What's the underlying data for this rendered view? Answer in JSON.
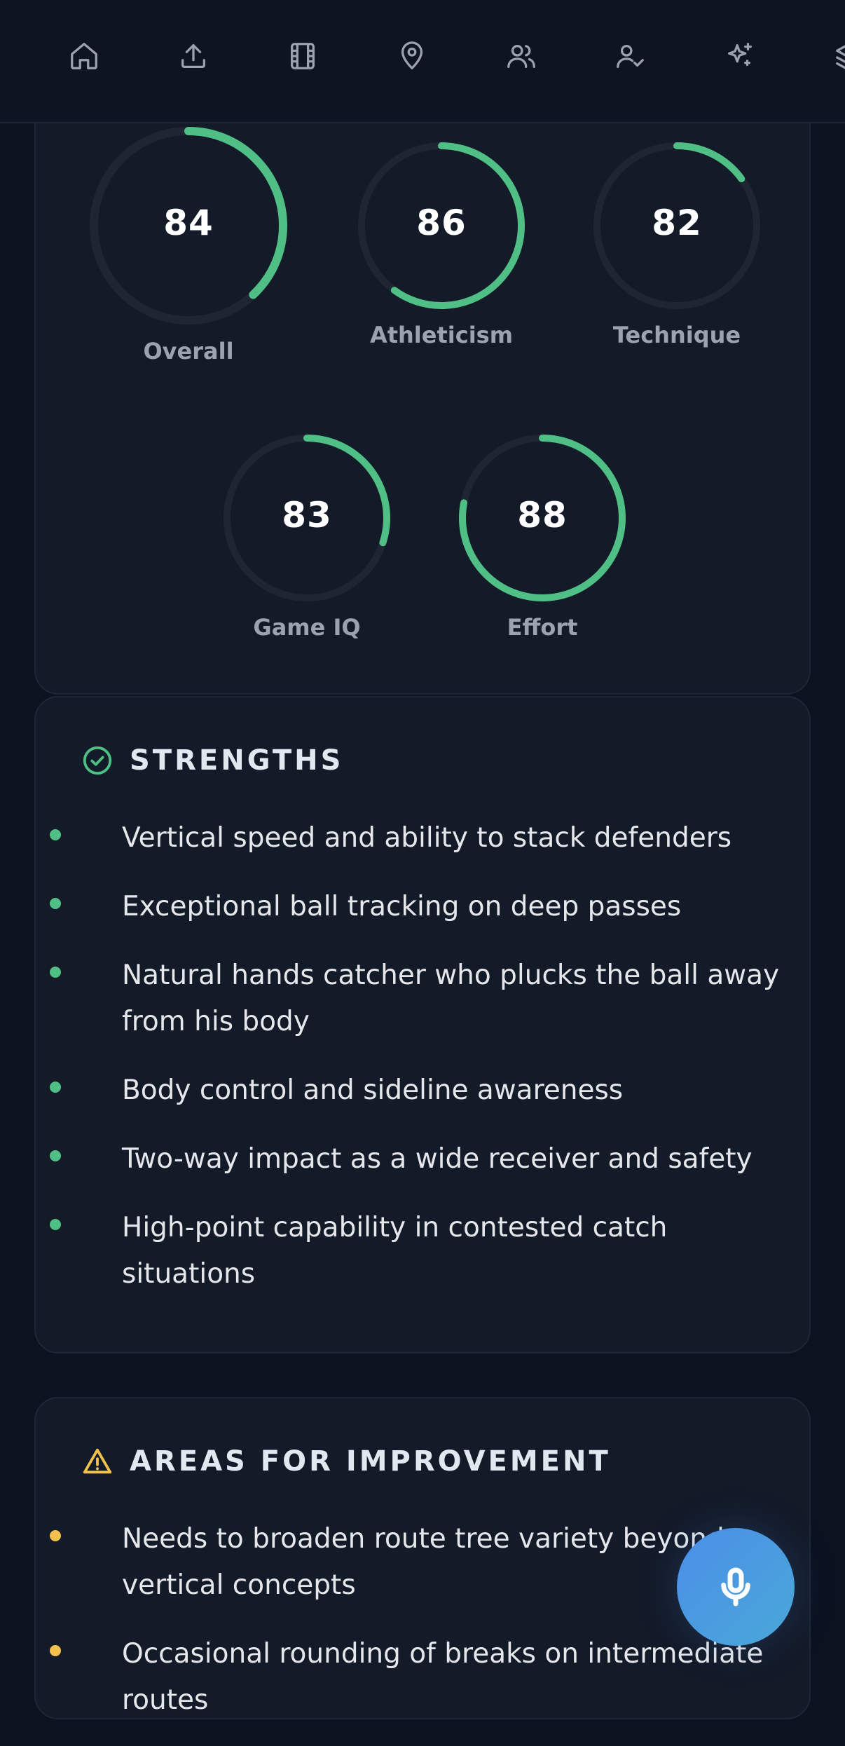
{
  "nav": {
    "icons": [
      "home-icon",
      "upload-icon",
      "film-icon",
      "map-pin-icon",
      "users-icon",
      "user-check-icon",
      "sparkles-icon",
      "layers-icon"
    ]
  },
  "scores": [
    {
      "label": "Overall",
      "value": "84",
      "progress": 0.38
    },
    {
      "label": "Athleticism",
      "value": "86",
      "progress": 0.6
    },
    {
      "label": "Technique",
      "value": "82",
      "progress": 0.15
    },
    {
      "label": "Game IQ",
      "value": "83",
      "progress": 0.3
    },
    {
      "label": "Effort",
      "value": "88",
      "progress": 0.78
    }
  ],
  "strengths": {
    "title": "STRENGTHS",
    "items": [
      "Vertical speed and ability to stack defenders",
      "Exceptional ball tracking on deep passes",
      "Natural hands catcher who plucks the ball away from his body",
      "Body control and sideline awareness",
      "Two-way impact as a wide receiver and safety",
      "High-point capability in contested catch situations"
    ]
  },
  "improvement": {
    "title": "AREAS FOR IMPROVEMENT",
    "items": [
      "Needs to broaden route tree variety beyond vertical concepts",
      "Occasional rounding of breaks on intermediate routes"
    ]
  },
  "colors": {
    "accent_green": "#4fbf85",
    "warning_yellow": "#f2c14e",
    "mic_blue": "#4b8ee8"
  }
}
